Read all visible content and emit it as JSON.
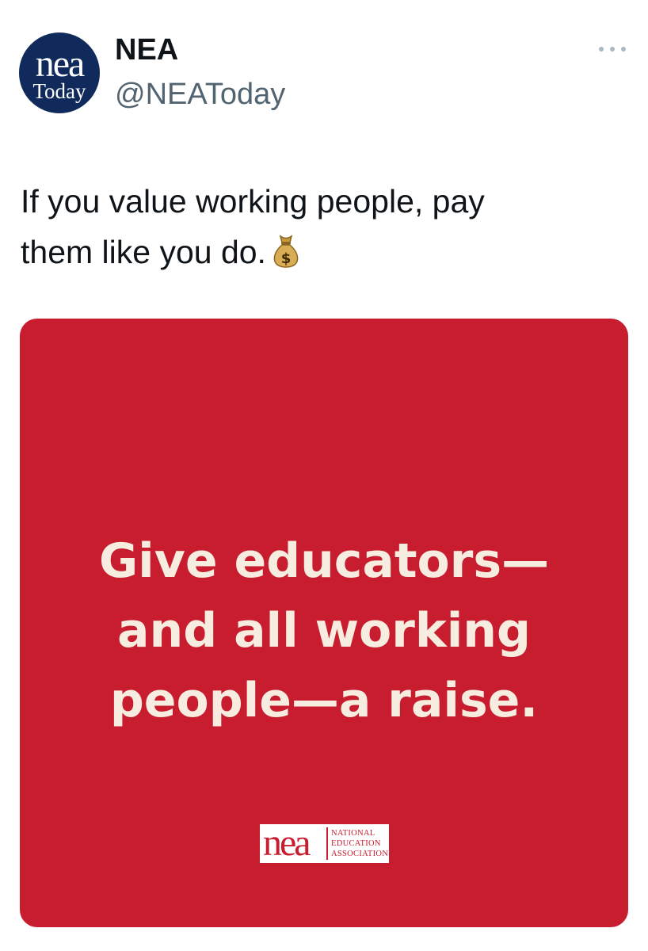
{
  "author": {
    "display_name": "NEA",
    "handle": "@NEAToday",
    "avatar": {
      "line1": "nea",
      "line2": "Today",
      "background": "#102a5c"
    }
  },
  "menu": {
    "icon": "more-horizontal-icon"
  },
  "tweet": {
    "text_line1": "If you value working people, pay",
    "text_line2": "them like you do.",
    "emoji_icon": "money-bag-icon"
  },
  "media": {
    "background": "#c71d2e",
    "headline": [
      "Give educators—",
      "and all working",
      "people—a raise."
    ],
    "logo": {
      "mark": "nea",
      "lines": [
        "NATIONAL",
        "EDUCATION",
        "ASSOCIATION"
      ]
    }
  }
}
